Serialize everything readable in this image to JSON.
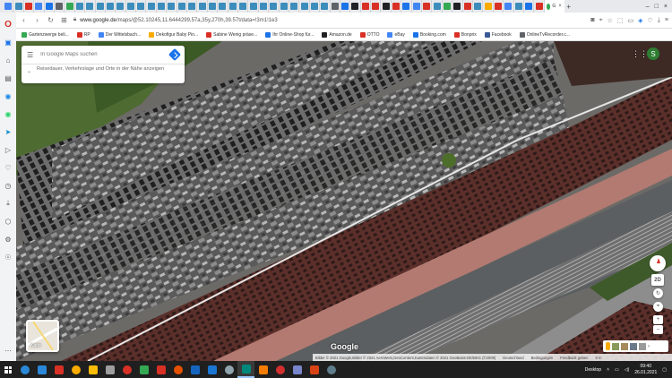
{
  "tabs": {
    "active_title": "G",
    "favicon_colors": [
      "#4285f4",
      "#3c8dbc",
      "#d93025",
      "#4285f4",
      "#1a73e8",
      "#5f6368",
      "#34a853",
      "#3c8dbc",
      "#3c8dbc",
      "#3c8dbc",
      "#3c8dbc",
      "#3c8dbc",
      "#3c8dbc",
      "#3c8dbc",
      "#3c8dbc",
      "#3c8dbc",
      "#3c8dbc",
      "#3c8dbc",
      "#3c8dbc",
      "#3c8dbc",
      "#3c8dbc",
      "#3c8dbc",
      "#3c8dbc",
      "#3c8dbc",
      "#3c8dbc",
      "#3c8dbc",
      "#3c8dbc",
      "#3c8dbc",
      "#3c8dbc",
      "#3c8dbc",
      "#3c8dbc",
      "#3c8dbc",
      "#5f6368",
      "#1a73e8",
      "#202124",
      "#d93025",
      "#d93025",
      "#202124",
      "#d93025",
      "#1a73e8",
      "#4285f4",
      "#d93025",
      "#3c8dbc",
      "#34a853",
      "#202124",
      "#d93025",
      "#3c8dbc",
      "#f9ab00",
      "#d93025",
      "#4285f4",
      "#3c8dbc",
      "#1a73e8",
      "#d93025"
    ]
  },
  "window": {
    "close": "×",
    "minimize": "–",
    "maximize": "□",
    "add_tab": "+"
  },
  "address": {
    "url_host": "www.google.de",
    "url_path": "/maps/@52.10245,11.6444299,57a,35y,270h,39.57t/data=!3m1!1e3"
  },
  "bookmarks": [
    {
      "label": "Gartenzwerge beli...",
      "color": "#34a853"
    },
    {
      "label": "RP",
      "color": "#d93025"
    },
    {
      "label": "Der Wittelsbach...",
      "color": "#4285f4"
    },
    {
      "label": "Dekofigur Baby Pin...",
      "color": "#f9ab00"
    },
    {
      "label": "Sabine Wenig präse...",
      "color": "#d93025"
    },
    {
      "label": "Ihr Online-Shop für...",
      "color": "#1a73e8"
    },
    {
      "label": "Amazon.de",
      "color": "#202124"
    },
    {
      "label": "OTTO",
      "color": "#d93025"
    },
    {
      "label": "eBay",
      "color": "#4285f4"
    },
    {
      "label": "Booking.com",
      "color": "#1a73e8"
    },
    {
      "label": "Bonprix",
      "color": "#d93025"
    },
    {
      "label": "Facebook",
      "color": "#3b5998"
    },
    {
      "label": "OnlineTvRecorder.c...",
      "color": "#5f6368"
    }
  ],
  "search": {
    "placeholder": "In Google Maps suchen",
    "travel_info": "Reisedauer, Verkehrslage und Orte in der Nähe anzeigen"
  },
  "user": {
    "avatar_letter": "S"
  },
  "map": {
    "logo": "Google",
    "layer_label": "Karte",
    "tilt_label": "2D",
    "attribution": [
      "Bilder © 2021 Google,Bilder © 2021 AeroWest,GeoContent,Kartendaten © 2021 GeoBasis-DE/BKG (©2009)",
      "Deutschland",
      "Bedingungen",
      "Feedback geben",
      "5 m"
    ]
  },
  "taskbar": {
    "desktop_label": "Desktop",
    "time": "09:40",
    "date": "26.01.2021",
    "app_colors": [
      "#2b88d8",
      "#2b88d8",
      "#d93025",
      "#f9ab00",
      "#fbbc05",
      "#9e9e9e",
      "#d93025",
      "#34a853",
      "#d93025",
      "#e65100",
      "#1565c0",
      "#1976d2",
      "#90a4ae",
      "#00897b",
      "#f57c00",
      "#d32f2f",
      "#7986cb",
      "#d84315",
      "#607d8b"
    ]
  }
}
